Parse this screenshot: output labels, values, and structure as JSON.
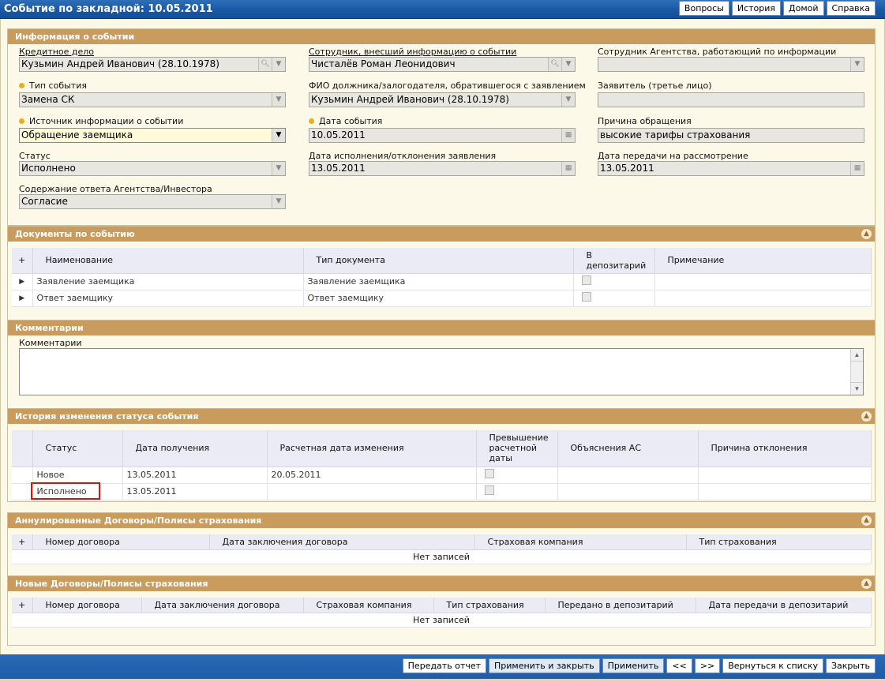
{
  "window": {
    "title": "Событие по закладной: 10.05.2011"
  },
  "topnav": [
    "Вопросы",
    "История",
    "Домой",
    "Справка"
  ],
  "info": {
    "header": "Информация о событии",
    "credit_case": {
      "label": "Кредитное дело",
      "value": "Кузьмин Андрей Иванович (28.10.1978)"
    },
    "employee": {
      "label": "Сотрудник, внесший информацию о событии",
      "value": "Чисталёв Роман Леонидович"
    },
    "agency_employee": {
      "label": "Сотрудник Агентства, работающий по информации",
      "value": ""
    },
    "event_type": {
      "label": "Тип события",
      "value": "Замена СК"
    },
    "debtor": {
      "label": "ФИО должника/залогодателя, обратившегося с заявлением",
      "value": "Кузьмин Андрей Иванович (28.10.1978)"
    },
    "applicant": {
      "label": "Заявитель (третье лицо)",
      "value": ""
    },
    "source": {
      "label": "Источник информации о событии",
      "value": "Обращение заемщика"
    },
    "event_date": {
      "label": "Дата события",
      "value": "10.05.2011"
    },
    "reason": {
      "label": "Причина обращения",
      "value": "высокие тарифы страхования"
    },
    "status": {
      "label": "Статус",
      "value": "Исполнено"
    },
    "exec_date": {
      "label": "Дата исполнения/отклонения заявления",
      "value": "13.05.2011"
    },
    "transfer_date": {
      "label": "Дата передачи на рассмотрение",
      "value": "13.05.2011"
    },
    "answer": {
      "label": "Содержание ответа Агентства/Инвестора",
      "value": "Согласие"
    }
  },
  "documents": {
    "header": "Документы по событию",
    "columns": [
      "+",
      "Наименование",
      "Тип документа",
      "В депозитарий",
      "Примечание"
    ],
    "rows": [
      {
        "name": "Заявление заемщика",
        "type": "Заявление заемщика",
        "note": ""
      },
      {
        "name": "Ответ заемщику",
        "type": "Ответ заемщику",
        "note": ""
      }
    ]
  },
  "comments": {
    "header": "Комментарии",
    "label": "Комментарии",
    "value": ""
  },
  "history": {
    "header": "История изменения статуса события",
    "columns": [
      "Статус",
      "Дата получения",
      "Расчетная дата изменения",
      "Превышение расчетной даты",
      "Объяснения АС",
      "Причина отклонения"
    ],
    "rows": [
      {
        "status": "Новое",
        "received": "13.05.2011",
        "calc_date": "20.05.2011"
      },
      {
        "status": "Исполнено",
        "received": "13.05.2011",
        "calc_date": ""
      }
    ]
  },
  "annulled": {
    "header": "Аннулированные Договоры/Полисы страхования",
    "columns": [
      "+",
      "Номер договора",
      "Дата заключения договора",
      "Страховая компания",
      "Тип страхования"
    ],
    "empty": "Нет записей"
  },
  "new_contracts": {
    "header": "Новые Договоры/Полисы страхования",
    "columns": [
      "+",
      "Номер договора",
      "Дата заключения договора",
      "Страховая компания",
      "Тип страхования",
      "Передано в депозитарий",
      "Дата передачи в депозитарий"
    ],
    "empty": "Нет записей"
  },
  "bottomnav": [
    "Передать отчет",
    "Применить и закрыть",
    "Применить",
    "<<",
    ">>",
    "Вернуться к списку",
    "Закрыть"
  ],
  "colors": {
    "section_header": "#c99b5c",
    "titlebar": "#1a5aa8",
    "highlight": "#e01010"
  }
}
